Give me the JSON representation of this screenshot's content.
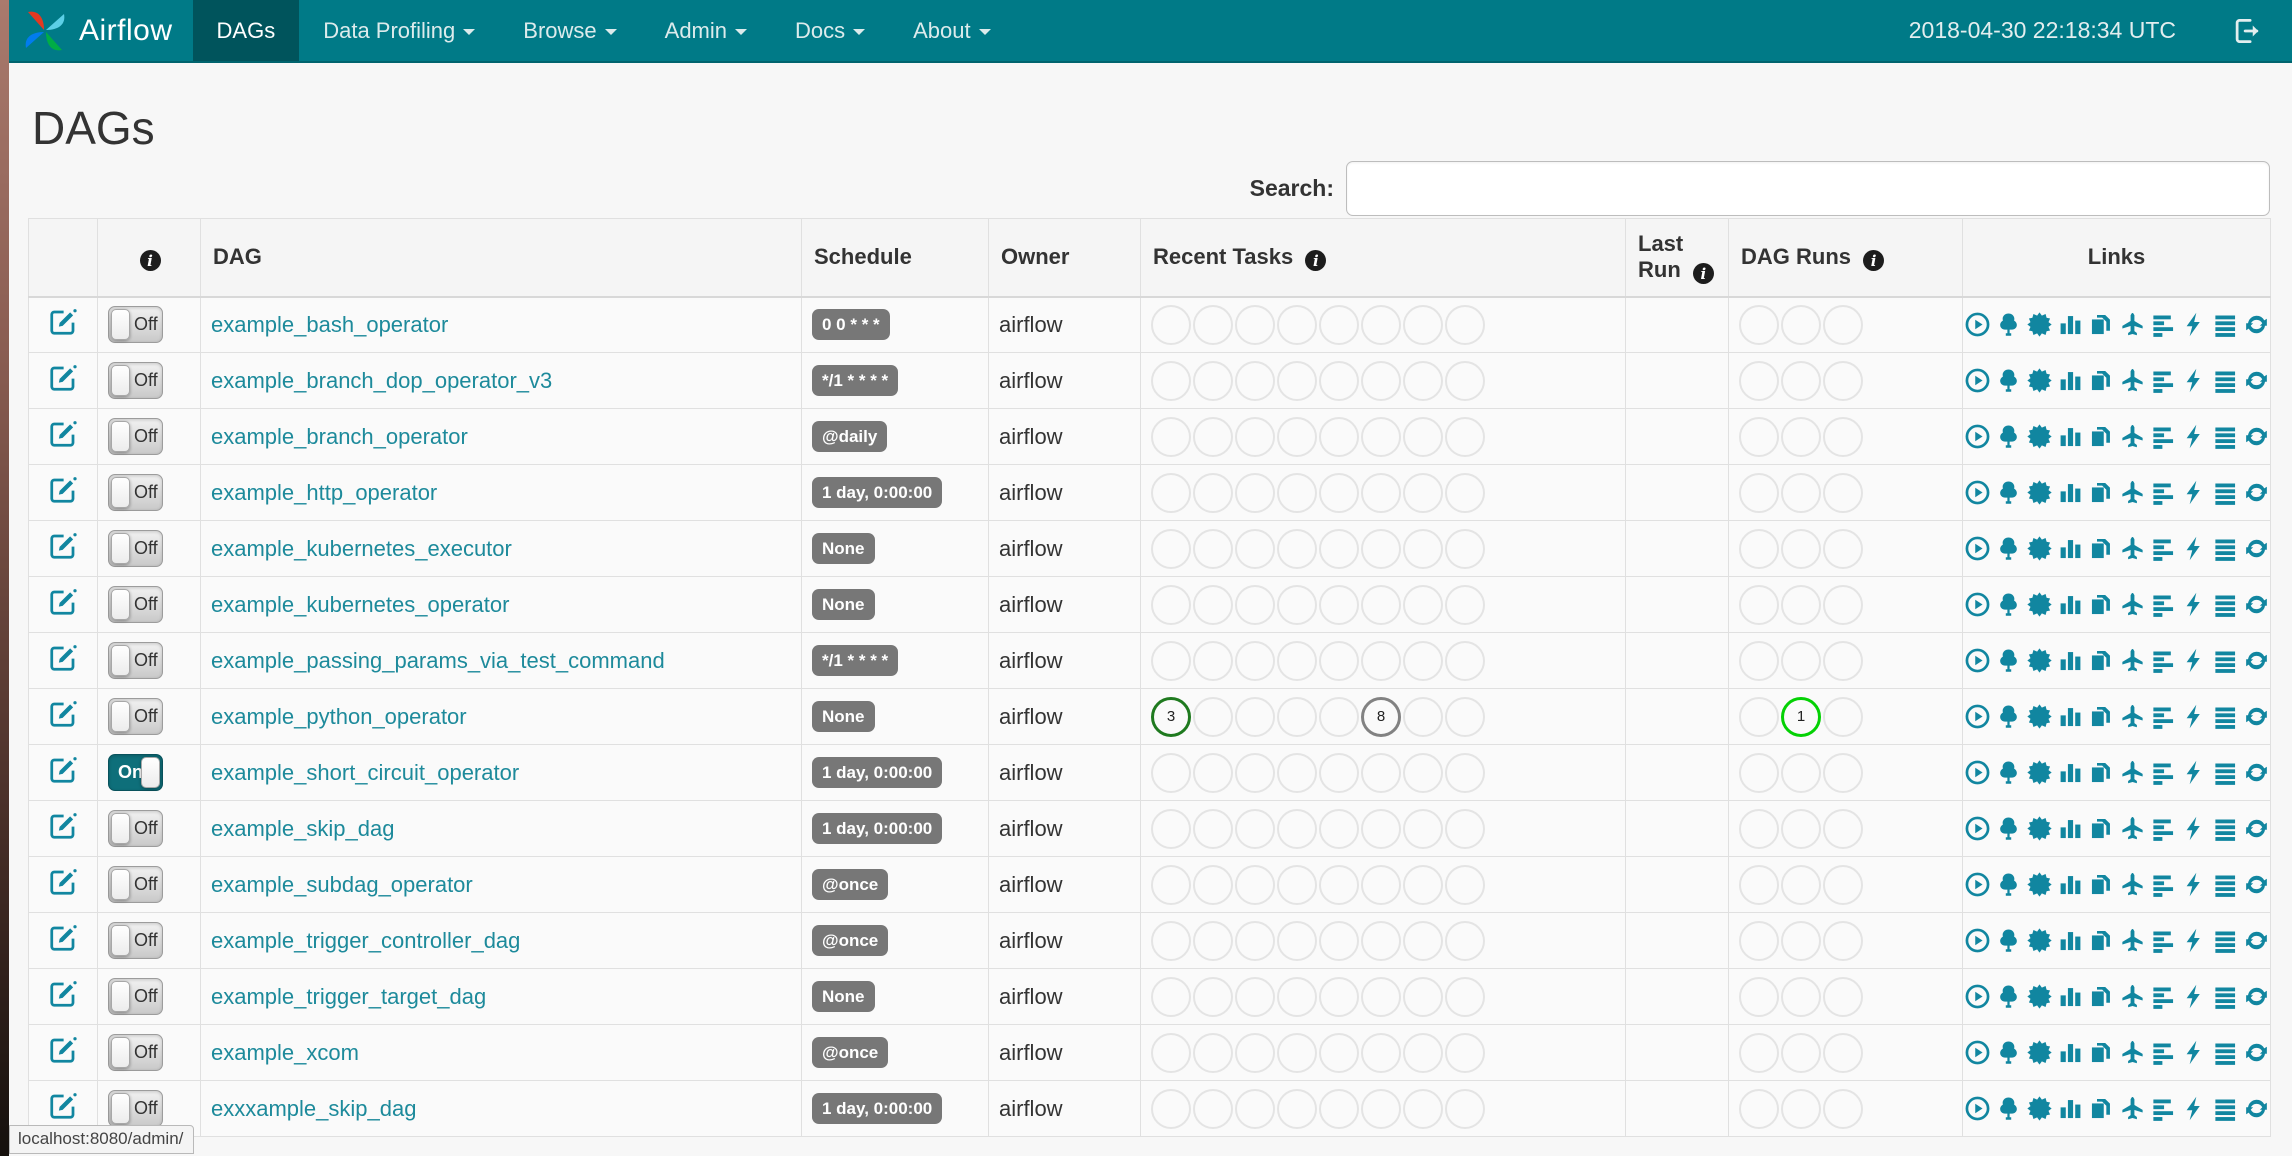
{
  "navbar": {
    "brand": "Airflow",
    "items": [
      {
        "label": "DAGs",
        "active": true,
        "dropdown": false
      },
      {
        "label": "Data Profiling",
        "active": false,
        "dropdown": true
      },
      {
        "label": "Browse",
        "active": false,
        "dropdown": true
      },
      {
        "label": "Admin",
        "active": false,
        "dropdown": true
      },
      {
        "label": "Docs",
        "active": false,
        "dropdown": true
      },
      {
        "label": "About",
        "active": false,
        "dropdown": true
      }
    ],
    "clock": "2018-04-30 22:18:34 UTC",
    "logout_icon": "sign-out-icon"
  },
  "page": {
    "title": "DAGs",
    "search_label": "Search:",
    "search_value": "",
    "status_bar": "localhost:8080/admin/"
  },
  "table": {
    "headers": {
      "edit": "",
      "info_icon": "i",
      "dag": "DAG",
      "schedule": "Schedule",
      "owner": "Owner",
      "recent_tasks": "Recent Tasks",
      "last_run": "Last Run",
      "dag_runs": "DAG Runs",
      "links": "Links"
    },
    "recent_task_slots": 8,
    "dag_run_slots": 3,
    "toggle_on_label": "On",
    "toggle_off_label": "Off",
    "link_icons": [
      "trigger-icon",
      "tree-view-icon",
      "graph-view-icon",
      "task-duration-icon",
      "task-tries-icon",
      "landing-times-icon",
      "gantt-icon",
      "code-view-icon",
      "logs-icon",
      "refresh-icon"
    ],
    "rows": [
      {
        "dag_id": "example_bash_operator",
        "enabled": false,
        "schedule": "0 0 * * *",
        "owner": "airflow",
        "recent_tasks": [],
        "dag_runs": []
      },
      {
        "dag_id": "example_branch_dop_operator_v3",
        "enabled": false,
        "schedule": "*/1 * * * *",
        "owner": "airflow",
        "recent_tasks": [],
        "dag_runs": []
      },
      {
        "dag_id": "example_branch_operator",
        "enabled": false,
        "schedule": "@daily",
        "owner": "airflow",
        "recent_tasks": [],
        "dag_runs": []
      },
      {
        "dag_id": "example_http_operator",
        "enabled": false,
        "schedule": "1 day, 0:00:00",
        "owner": "airflow",
        "recent_tasks": [],
        "dag_runs": []
      },
      {
        "dag_id": "example_kubernetes_executor",
        "enabled": false,
        "schedule": "None",
        "owner": "airflow",
        "recent_tasks": [],
        "dag_runs": []
      },
      {
        "dag_id": "example_kubernetes_operator",
        "enabled": false,
        "schedule": "None",
        "owner": "airflow",
        "recent_tasks": [],
        "dag_runs": []
      },
      {
        "dag_id": "example_passing_params_via_test_command",
        "enabled": false,
        "schedule": "*/1 * * * *",
        "owner": "airflow",
        "recent_tasks": [],
        "dag_runs": []
      },
      {
        "dag_id": "example_python_operator",
        "enabled": false,
        "schedule": "None",
        "owner": "airflow",
        "recent_tasks": [
          {
            "slot": 1,
            "count": "3",
            "state": "success"
          },
          {
            "slot": 6,
            "count": "8",
            "state": "none"
          }
        ],
        "dag_runs": [
          {
            "slot": 2,
            "count": "1",
            "state": "running"
          }
        ]
      },
      {
        "dag_id": "example_short_circuit_operator",
        "enabled": true,
        "schedule": "1 day, 0:00:00",
        "owner": "airflow",
        "recent_tasks": [],
        "dag_runs": []
      },
      {
        "dag_id": "example_skip_dag",
        "enabled": false,
        "schedule": "1 day, 0:00:00",
        "owner": "airflow",
        "recent_tasks": [],
        "dag_runs": []
      },
      {
        "dag_id": "example_subdag_operator",
        "enabled": false,
        "schedule": "@once",
        "owner": "airflow",
        "recent_tasks": [],
        "dag_runs": []
      },
      {
        "dag_id": "example_trigger_controller_dag",
        "enabled": false,
        "schedule": "@once",
        "owner": "airflow",
        "recent_tasks": [],
        "dag_runs": []
      },
      {
        "dag_id": "example_trigger_target_dag",
        "enabled": false,
        "schedule": "None",
        "owner": "airflow",
        "recent_tasks": [],
        "dag_runs": []
      },
      {
        "dag_id": "example_xcom",
        "enabled": false,
        "schedule": "@once",
        "owner": "airflow",
        "recent_tasks": [],
        "dag_runs": []
      },
      {
        "dag_id": "exxxample_skip_dag",
        "enabled": false,
        "schedule": "1 day, 0:00:00",
        "owner": "airflow",
        "recent_tasks": [],
        "dag_runs": []
      }
    ]
  },
  "colors": {
    "navbar": "#007a87",
    "nav_active": "#00545c",
    "link": "#1d8a9b",
    "icon": "#1186a0",
    "badge_bg": "#777777",
    "state_success": "#1f7a1f",
    "state_none": "#828282",
    "state_running": "#04d104",
    "toggle_on": "#0e6f7a"
  }
}
